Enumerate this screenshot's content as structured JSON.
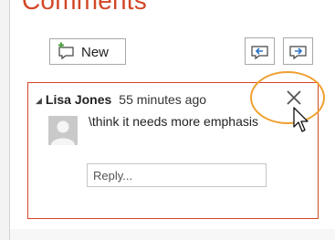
{
  "pane": {
    "title": "Comments"
  },
  "toolbar": {
    "new_label": "New",
    "prev_icon": "previous-comment-icon",
    "next_icon": "next-comment-icon"
  },
  "comment": {
    "author": "Lisa Jones",
    "time": "55 minutes ago",
    "text": "\\think it needs more emphasis",
    "reply_placeholder": "Reply...",
    "close_icon": "close-x-icon"
  },
  "colors": {
    "accent": "#d24726",
    "highlight": "#f0a030"
  }
}
